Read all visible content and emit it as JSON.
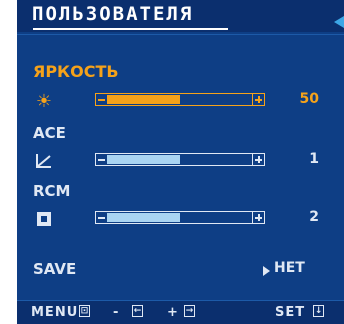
{
  "header": {
    "title": "ПОЛЬЗОВАТЕЛЯ"
  },
  "items": [
    {
      "label": "ЯРКОСТЬ",
      "icon": "sun-icon",
      "icon_glyph": "☀",
      "fill_fraction": 0.5,
      "value": "50",
      "active": true
    },
    {
      "label": "ACE",
      "icon": "ace-curve-icon",
      "icon_glyph": "⟀",
      "fill_fraction": 0.5,
      "value": "1",
      "active": false
    },
    {
      "label": "RCM",
      "icon": "rcm-square-icon",
      "icon_glyph": "◘",
      "fill_fraction": 0.5,
      "value": "2",
      "active": false
    }
  ],
  "save": {
    "label": "SAVE",
    "value": "НЕТ"
  },
  "footer": {
    "menu_label": "MENU",
    "minus_label": "-",
    "plus_label": "+",
    "set_label": "SET"
  },
  "colors": {
    "background": "#0e3e85",
    "header_bg": "#0b2f6e",
    "accent": "#f5a21a",
    "text": "#e0e8f4",
    "slider_fill": "#a9d4f2"
  }
}
